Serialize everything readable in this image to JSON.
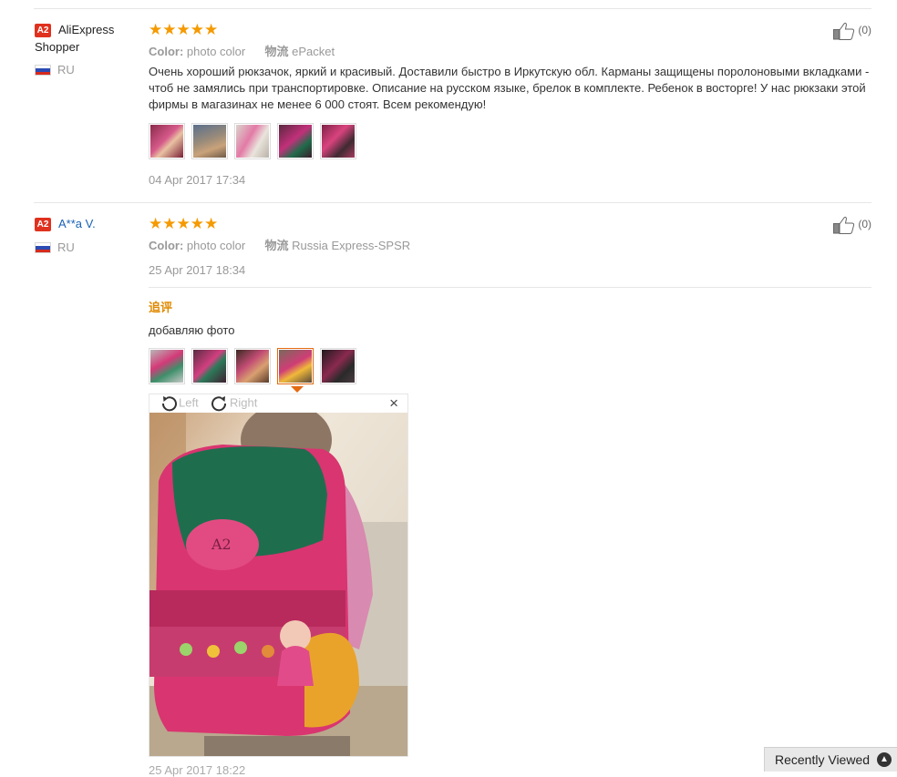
{
  "reviews": [
    {
      "badge": "A2",
      "user": "AliExpress Shopper",
      "country": "RU",
      "stars": "★★★★★",
      "color_label": "Color:",
      "color_value": "photo color",
      "ship_label": "物流",
      "ship_value": "ePacket",
      "text": "Очень хороший рюкзачок, яркий и красивый. Доставили быстро в Иркутскую обл. Карманы защищены поролоновыми вкладками - чтоб не замялись при транспортировке. Описание на русском языке, брелок в комплекте. Ребенок в восторге! У нас рюкзаки этой фирмы в магазинах не менее 6 000 стоят. Всем рекомендую!",
      "date": "04 Apr 2017 17:34",
      "likes": "(0)"
    },
    {
      "badge": "A2",
      "user": "A**a V.",
      "country": "RU",
      "stars": "★★★★★",
      "color_label": "Color:",
      "color_value": "photo color",
      "ship_label": "物流",
      "ship_value": "Russia Express-SPSR",
      "date": "25 Apr 2017 18:34",
      "likes": "(0)",
      "additional_label": "追评",
      "additional_text": "добавляю фото",
      "additional_date": "25 Apr 2017 18:22"
    }
  ],
  "viewer": {
    "rotate_left": "Left",
    "rotate_right": "Right",
    "close": "×"
  },
  "recently_viewed": "Recently Viewed",
  "colors": {
    "accent": "#e46b11",
    "star": "#f59a00",
    "badge": "#e0311e",
    "link": "#1a61b5"
  }
}
